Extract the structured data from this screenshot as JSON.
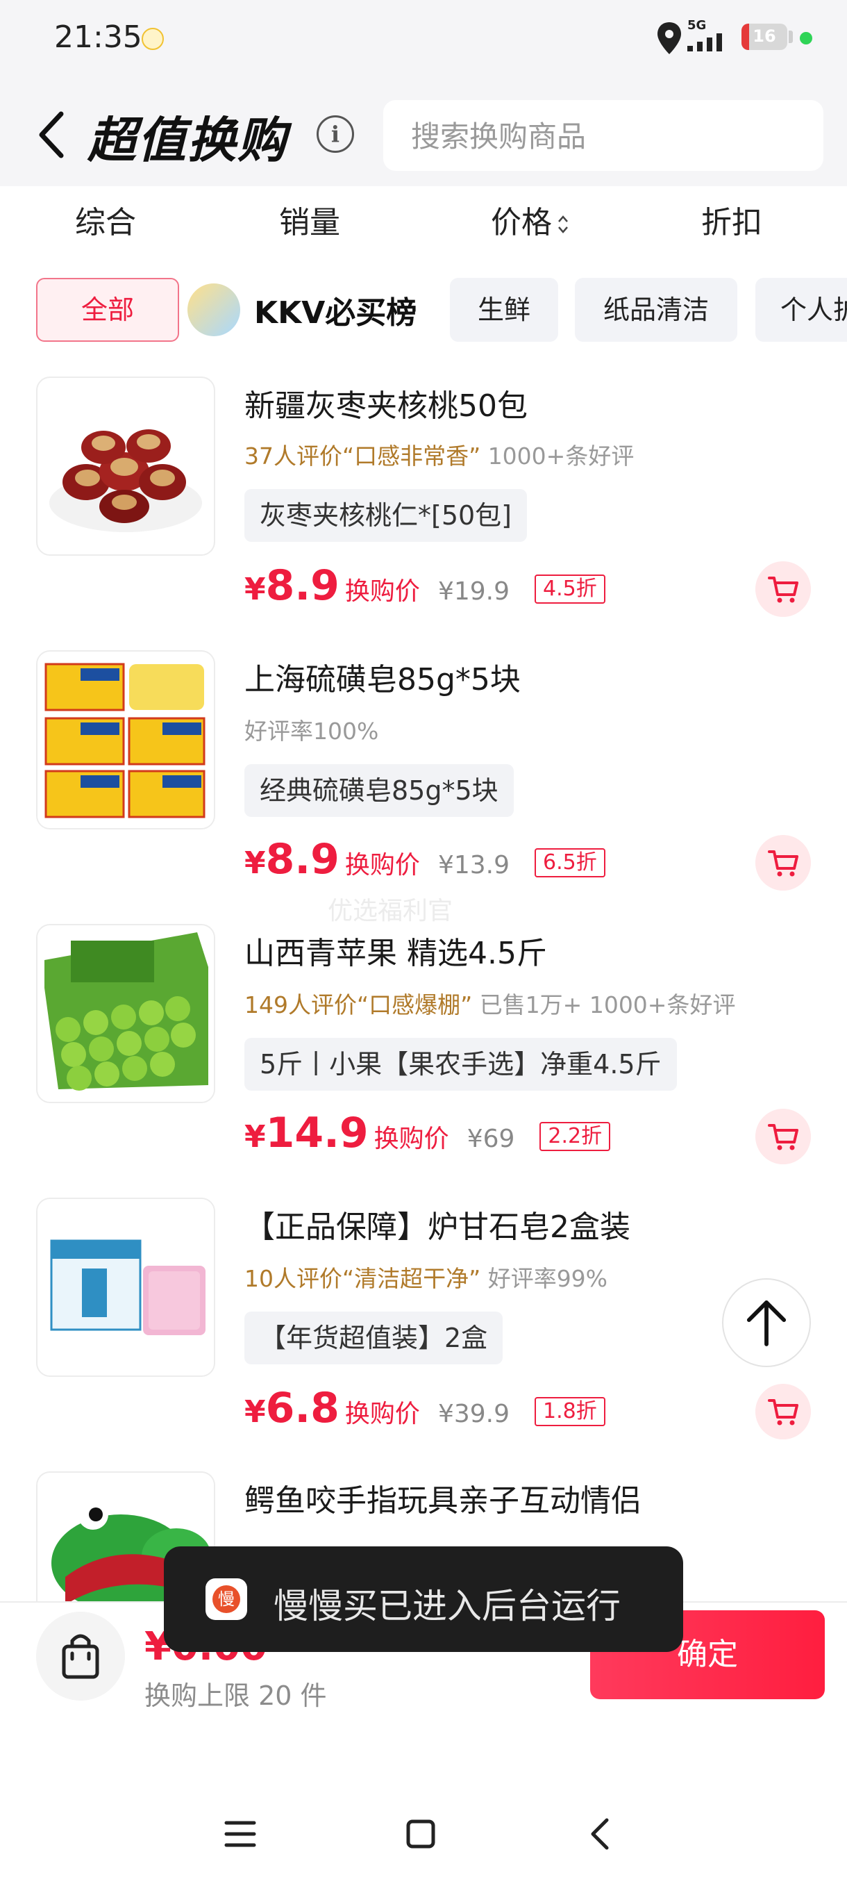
{
  "status_bar": {
    "time": "21:35",
    "network": "5G",
    "battery": "16",
    "battery_level": 0.16
  },
  "header": {
    "title": "超值换购",
    "info_icon": "i",
    "search_placeholder": "搜索换购商品"
  },
  "sort_tabs": [
    "综合",
    "销量",
    "价格",
    "折扣"
  ],
  "categories": {
    "all": "全部",
    "featured": "KKV必买榜",
    "chips": [
      "生鲜",
      "纸品清洁",
      "个人护"
    ]
  },
  "currency": "¥",
  "watermark": "优选福利官",
  "products": [
    {
      "name": "新疆灰枣夹核桃50包",
      "review_highlight": "37人评价“口感非常香”",
      "review_extra": "1000+条好评",
      "spec": "灰枣夹核桃仁*[50包]",
      "price": "8.9",
      "price_label": "换购价",
      "original_price": "¥19.9",
      "discount": "4.5折"
    },
    {
      "name": "上海硫磺皂85g*5块",
      "review_highlight": "",
      "review_extra": "好评率100%",
      "spec": "经典硫磺皂85g*5块",
      "price": "8.9",
      "price_label": "换购价",
      "original_price": "¥13.9",
      "discount": "6.5折"
    },
    {
      "name": "山西青苹果 精选4.5斤",
      "review_highlight": "149人评价“口感爆棚”",
      "review_extra": "已售1万+ 1000+条好评",
      "spec": "5斤丨小果【果农手选】净重4.5斤",
      "price": "14.9",
      "price_label": "换购价",
      "original_price": "¥69",
      "discount": "2.2折"
    },
    {
      "name": "【正品保障】炉甘石皂2盒装",
      "review_highlight": "10人评价“清洁超干净”",
      "review_extra": "好评率99%",
      "spec": "【年货超值装】2盒",
      "price": "6.8",
      "price_label": "换购价",
      "original_price": "¥39.9",
      "discount": "1.8折"
    },
    {
      "name": "鳄鱼咬手指玩具亲子互动情侣"
    }
  ],
  "bottom": {
    "total": "¥0.00",
    "limit": "换购上限 20 件",
    "confirm": "确定"
  },
  "toast": {
    "icon_char": "慢",
    "text": "慢慢买已进入后台运行"
  },
  "colors": {
    "accent": "#ee1d3f",
    "review_gold": "#b07a2a",
    "background": "#f5f5f7"
  }
}
